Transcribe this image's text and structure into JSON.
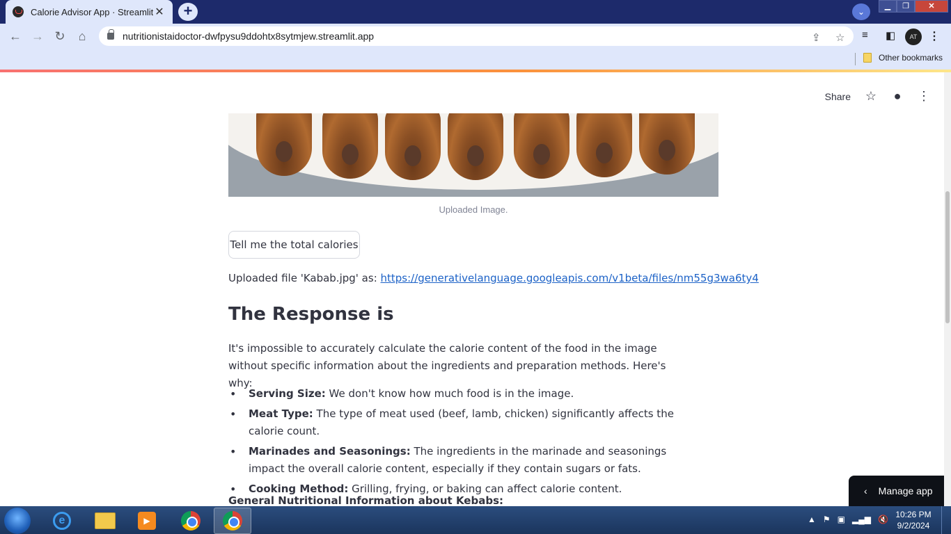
{
  "browser": {
    "tab_title": "Calorie Advisor App · Streamlit",
    "url": "nutritionistaidoctor-dwfpysu9ddohtx8sytmjew.streamlit.app",
    "bookmark": "Other bookmarks",
    "profile_initials": "AT"
  },
  "app": {
    "share_label": "Share",
    "image_caption": "Uploaded Image.",
    "button_label": "Tell me the total calories",
    "uploaded_prefix": "Uploaded file 'Kabab.jpg' as: ",
    "uploaded_link": "https://generativelanguage.googleapis.com/v1beta/files/nm55g3wa6ty4",
    "heading": "The Response is",
    "intro": "It's impossible to accurately calculate the calorie content of the food in the image without specific information about the ingredients and preparation methods. Here's why:",
    "bullets": [
      {
        "term": "Serving Size:",
        "text": " We don't know how much food is in the image."
      },
      {
        "term": "Meat Type:",
        "text": " The type of meat used (beef, lamb, chicken) significantly affects the calorie count."
      },
      {
        "term": "Marinades and Seasonings:",
        "text": " The ingredients in the marinade and seasonings impact the overall calorie content, especially if they contain sugars or fats."
      },
      {
        "term": "Cooking Method:",
        "text": " Grilling, frying, or baking can affect calorie content."
      }
    ],
    "subheading": "General Nutritional Information about Kebabs:",
    "manage_label": "Manage app"
  },
  "taskbar": {
    "time": "10:26 PM",
    "date": "9/2/2024"
  }
}
